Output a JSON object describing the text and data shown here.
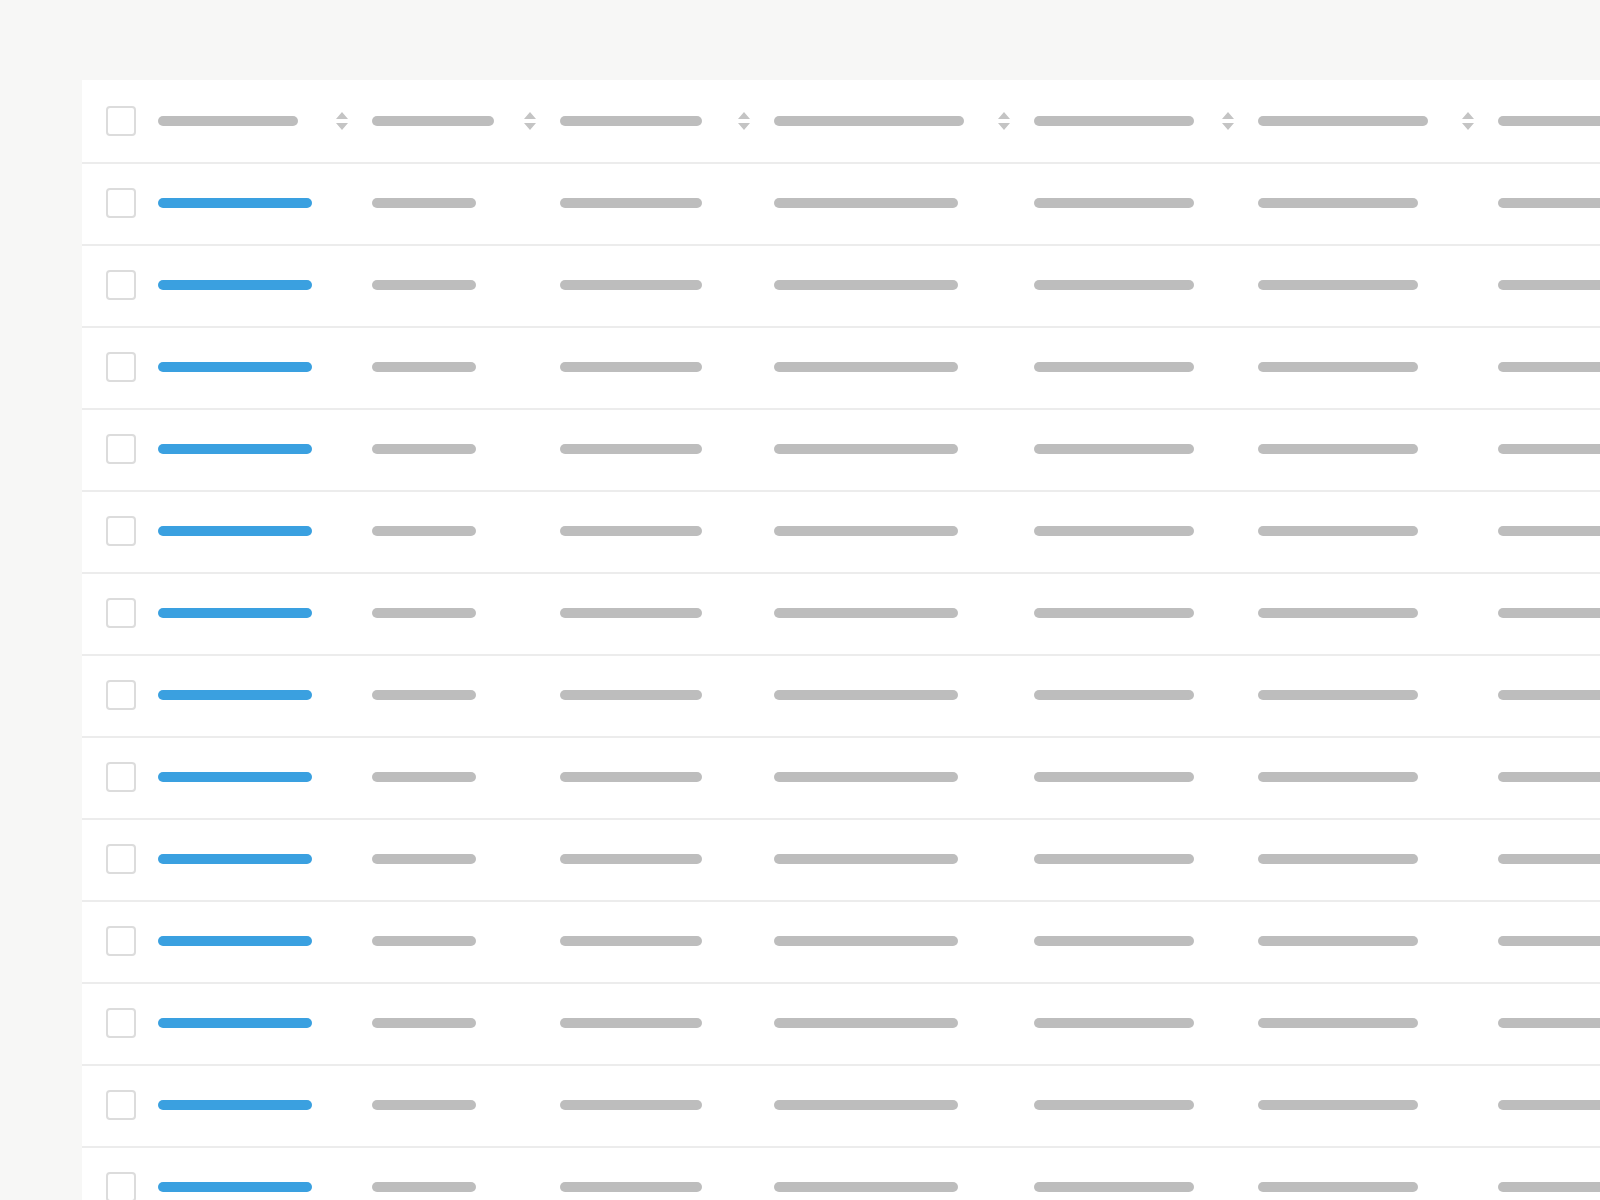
{
  "table": {
    "header": {
      "checked": false
    },
    "columns": [
      {
        "kind": "link",
        "sortable": true
      },
      {
        "kind": "plain",
        "sortable": true
      },
      {
        "kind": "plain",
        "sortable": true
      },
      {
        "kind": "plain",
        "sortable": true
      },
      {
        "kind": "plain",
        "sortable": true
      },
      {
        "kind": "plain",
        "sortable": true
      },
      {
        "kind": "plain"
      }
    ],
    "rows": [
      {
        "checked": false
      },
      {
        "checked": false
      },
      {
        "checked": false
      },
      {
        "checked": false
      },
      {
        "checked": false
      },
      {
        "checked": false
      },
      {
        "checked": false
      },
      {
        "checked": false
      },
      {
        "checked": false
      },
      {
        "checked": false
      },
      {
        "checked": false
      },
      {
        "checked": false
      },
      {
        "checked": false
      }
    ]
  }
}
